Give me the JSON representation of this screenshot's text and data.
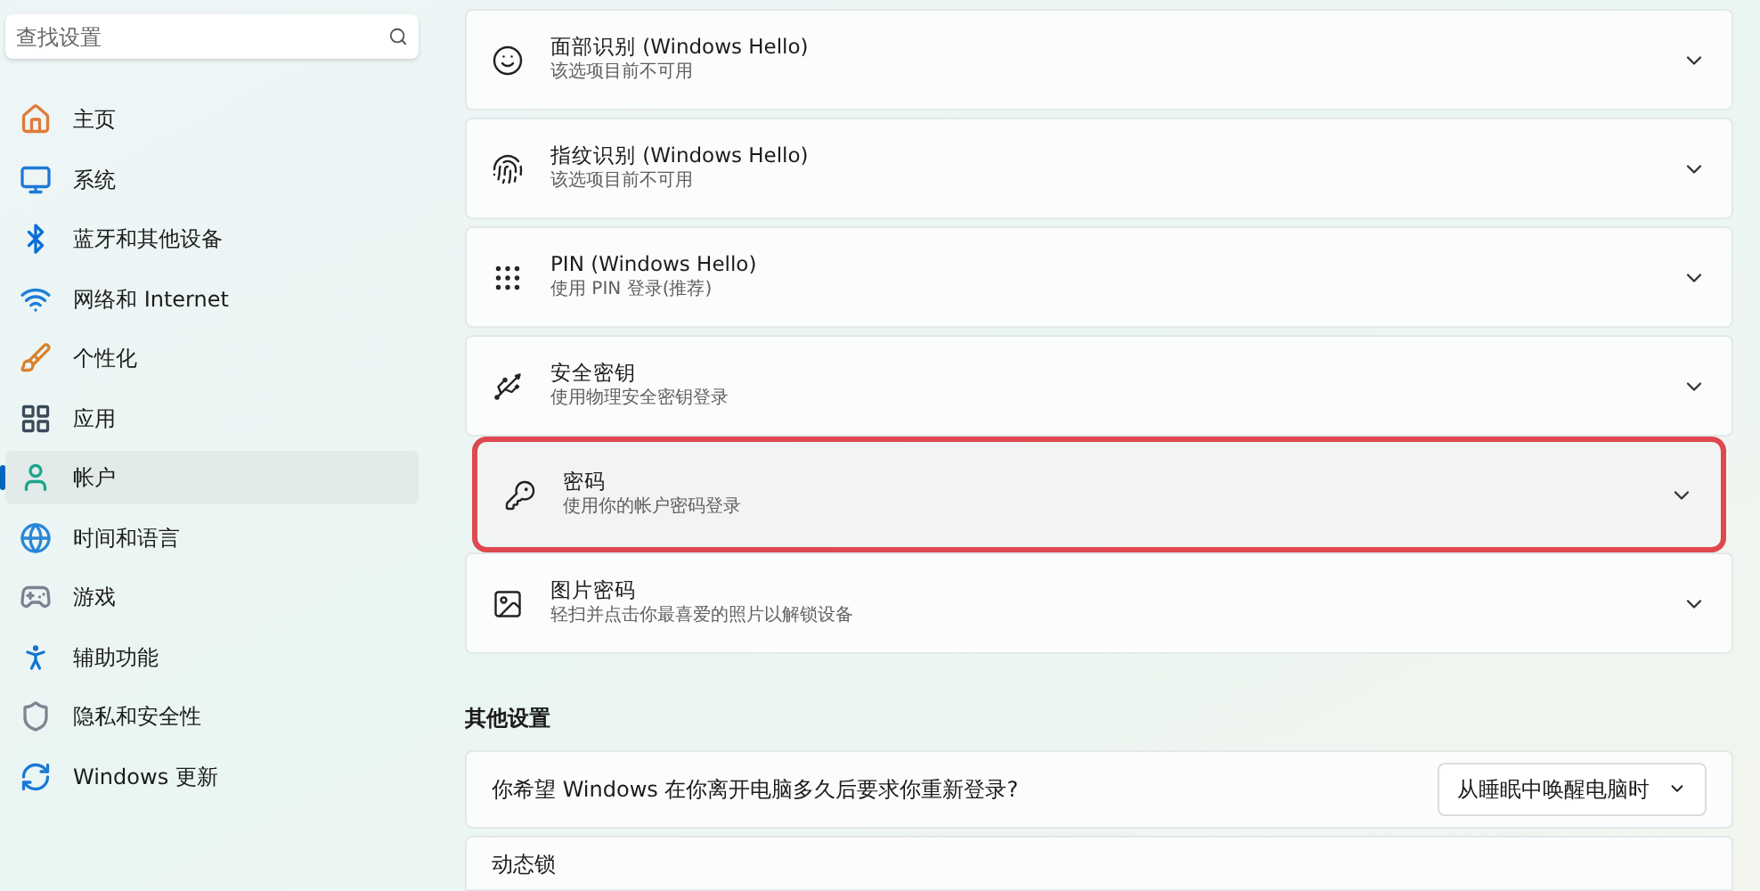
{
  "search": {
    "placeholder": "查找设置"
  },
  "sidebar": {
    "items": [
      {
        "label": "主页",
        "selected": false
      },
      {
        "label": "系统",
        "selected": false
      },
      {
        "label": "蓝牙和其他设备",
        "selected": false
      },
      {
        "label": "网络和 Internet",
        "selected": false
      },
      {
        "label": "个性化",
        "selected": false
      },
      {
        "label": "应用",
        "selected": false
      },
      {
        "label": "帐户",
        "selected": true
      },
      {
        "label": "时间和语言",
        "selected": false
      },
      {
        "label": "游戏",
        "selected": false
      },
      {
        "label": "辅助功能",
        "selected": false
      },
      {
        "label": "隐私和安全性",
        "selected": false
      },
      {
        "label": "Windows 更新",
        "selected": false
      }
    ]
  },
  "sign_in_options": [
    {
      "title": "面部识别 (Windows Hello)",
      "subtitle": "该选项目前不可用",
      "highlighted": false
    },
    {
      "title": "指纹识别 (Windows Hello)",
      "subtitle": "该选项目前不可用",
      "highlighted": false
    },
    {
      "title": "PIN (Windows Hello)",
      "subtitle": "使用 PIN 登录(推荐)",
      "highlighted": false
    },
    {
      "title": "安全密钥",
      "subtitle": "使用物理安全密钥登录",
      "highlighted": false
    },
    {
      "title": "密码",
      "subtitle": "使用你的帐户密码登录",
      "highlighted": true
    },
    {
      "title": "图片密码",
      "subtitle": "轻扫并点击你最喜爱的照片以解锁设备",
      "highlighted": false
    }
  ],
  "other_settings": {
    "heading": "其他设置",
    "relogin": {
      "label": "你希望 Windows 在你离开电脑多久后要求你重新登录?",
      "value": "从睡眠中唤醒电脑时"
    },
    "dynamic_lock": {
      "label": "动态锁"
    }
  }
}
